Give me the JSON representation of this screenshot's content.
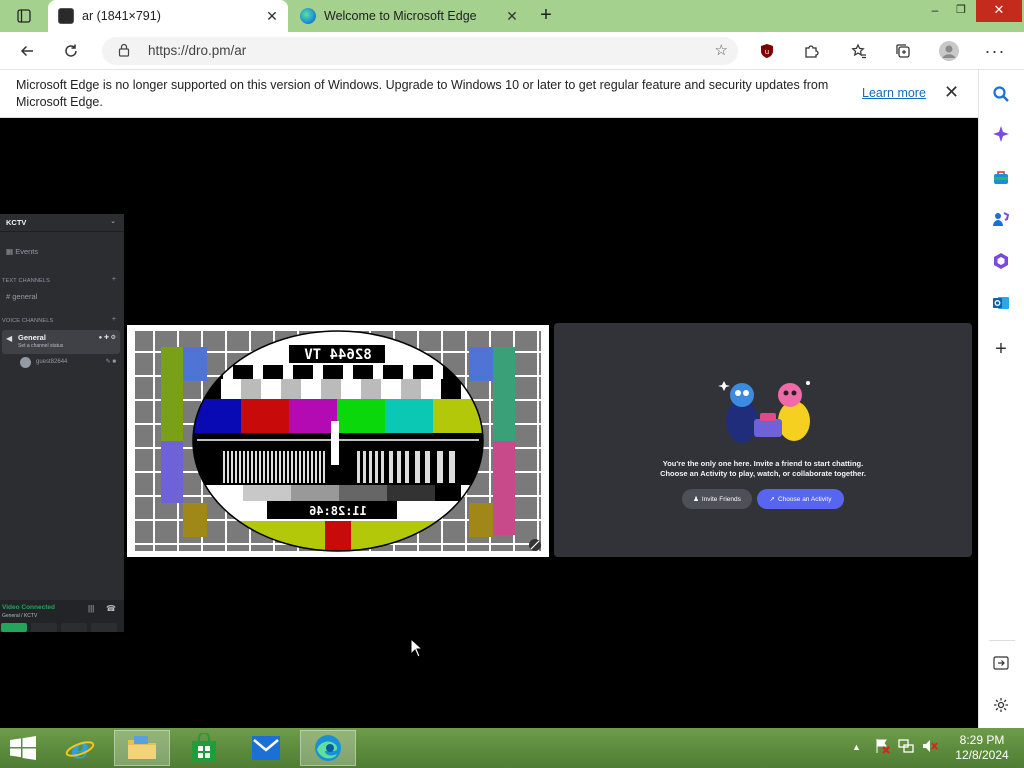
{
  "browser": {
    "tabs": [
      {
        "title": "ar (1841×791)",
        "active": true
      },
      {
        "title": "Welcome to Microsoft Edge",
        "active": false
      }
    ],
    "new_tab": "+",
    "address": {
      "url": "https://dro.pm/ar"
    },
    "window": {
      "minimize": "–",
      "restore": "❐",
      "close": "✕"
    }
  },
  "infobar": {
    "message": "Microsoft Edge is no longer supported on this version of Windows. Upgrade to Windows 10 or later to get regular feature and security updates from Microsoft Edge.",
    "learn_more": "Learn more"
  },
  "discord": {
    "server_name": "KCTV",
    "events_label": "Events",
    "text_category": "TEXT CHANNELS",
    "text_channel": "general",
    "voice_category": "VOICE CHANNELS",
    "voice_channel": "General",
    "voice_status": "Set a channel status",
    "voice_user": "guest82644",
    "connection_status": "Video Connected",
    "connection_location": "General / KCTV",
    "empty_line1": "You're the only one here. Invite a friend to start chatting.",
    "empty_line2": "Choose an Activity to play, watch, or collaborate together.",
    "invite_button": "Invite Friends",
    "activity_button": "Choose an Activity"
  },
  "testcard": {
    "top_text": "82644 TV",
    "time_text": "11:28:46"
  },
  "taskbar": {
    "time": "8:29 PM",
    "date": "12/8/2024"
  },
  "colors": {
    "tabstrip": "#a4d28e",
    "discord_blurple": "#5865f2",
    "discord_green": "#23a55a",
    "taskbar": "#5a8a3a"
  }
}
